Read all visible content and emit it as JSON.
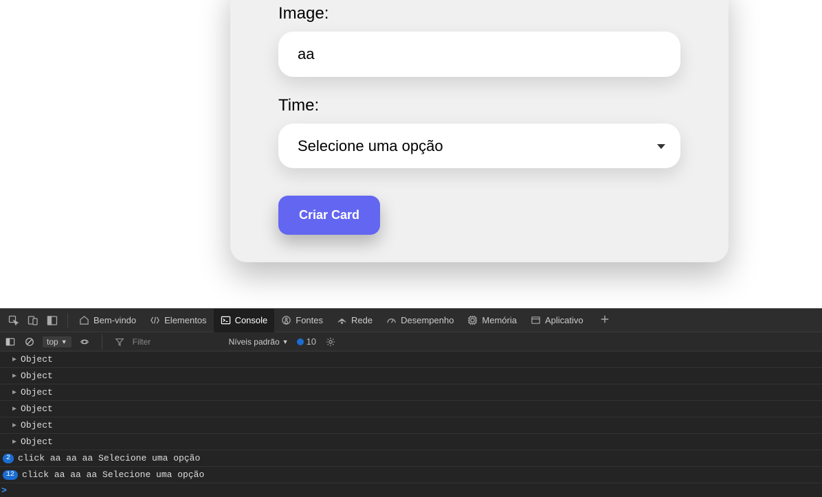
{
  "form": {
    "image_label": "Image:",
    "image_value": "aa",
    "time_label": "Time:",
    "time_selected": "Selecione uma opção",
    "submit_label": "Criar Card"
  },
  "devtools": {
    "tabs": {
      "welcome": "Bem-vindo",
      "elements": "Elementos",
      "console": "Console",
      "sources": "Fontes",
      "network": "Rede",
      "performance": "Desempenho",
      "memory": "Memória",
      "application": "Aplicativo"
    },
    "toolbar": {
      "context": "top",
      "filter_placeholder": "Filter",
      "levels_label": "Níveis padrão",
      "issue_count": "10"
    },
    "console": {
      "object_rows": [
        "Object",
        "Object",
        "Object",
        "Object",
        "Object",
        "Object"
      ],
      "log_rows": [
        {
          "count": "2",
          "text": "click aa aa aa Selecione uma opção"
        },
        {
          "count": "12",
          "text": "click aa aa aa Selecione uma opção"
        }
      ],
      "prompt": ">"
    }
  }
}
